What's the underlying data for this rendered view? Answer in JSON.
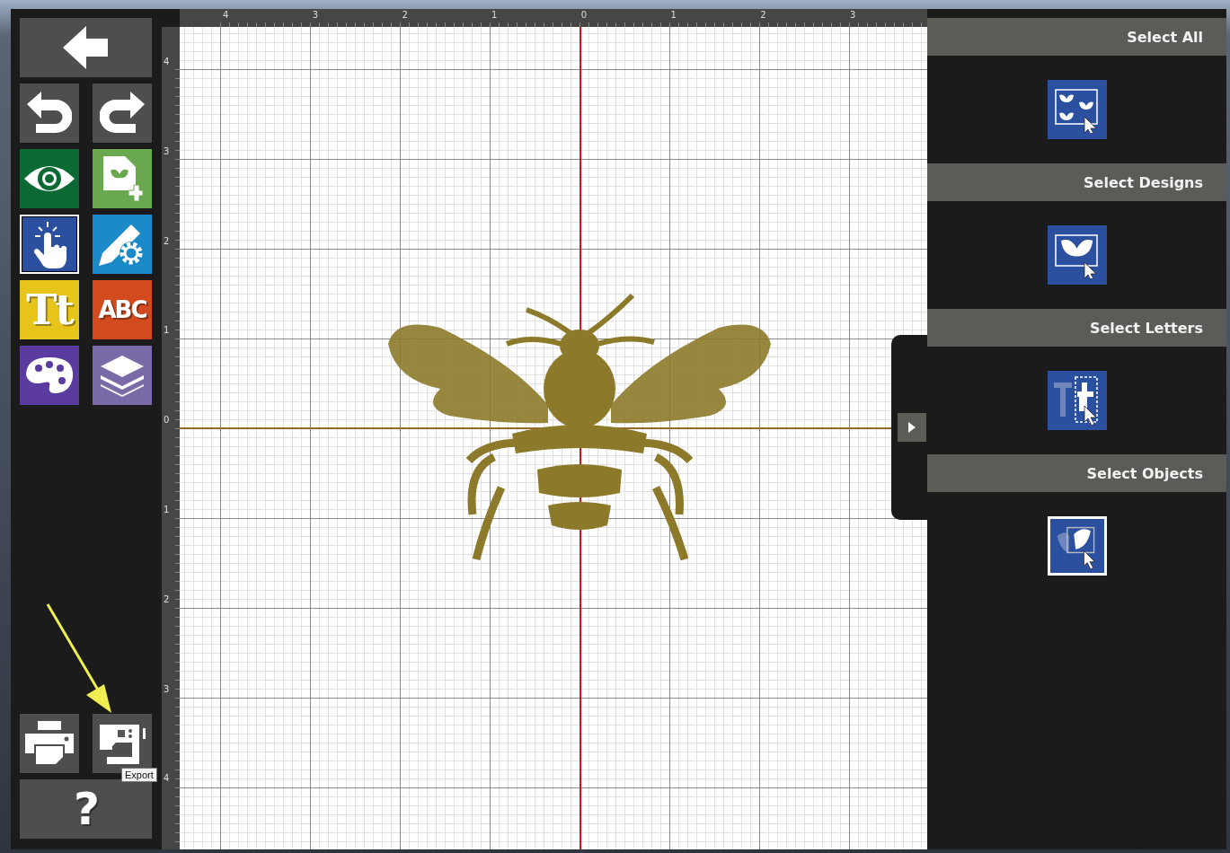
{
  "toolbar": {
    "tools": [
      {
        "kind": "back",
        "selected": false
      },
      {
        "kind": "undo",
        "selected": false
      },
      {
        "kind": "redo",
        "selected": false
      },
      {
        "kind": "preview",
        "selected": false
      },
      {
        "kind": "add-design",
        "selected": false
      },
      {
        "kind": "select",
        "selected": true
      },
      {
        "kind": "edit",
        "selected": false
      },
      {
        "kind": "text",
        "selected": false,
        "glyph": "Tt"
      },
      {
        "kind": "monogram",
        "selected": false,
        "glyph": "ABC"
      },
      {
        "kind": "color",
        "selected": false
      },
      {
        "kind": "layers",
        "selected": false
      }
    ],
    "bottom_tools": [
      {
        "kind": "print",
        "selected": false
      },
      {
        "kind": "export",
        "selected": false,
        "tooltip": "Export"
      },
      {
        "kind": "help",
        "selected": false,
        "glyph": "?"
      }
    ]
  },
  "horizontal_ruler": {
    "labels": [
      "4",
      "3",
      "2",
      "1",
      "0",
      "1",
      "2",
      "3"
    ]
  },
  "vertical_ruler": {
    "labels": [
      "4",
      "3",
      "2",
      "1",
      "0",
      "1",
      "2",
      "3",
      "4"
    ]
  },
  "select_panel": {
    "sections": [
      {
        "heading": "Select All",
        "kind": "all",
        "selected": false
      },
      {
        "heading": "Select Designs",
        "kind": "designs",
        "selected": false
      },
      {
        "heading": "Select Letters",
        "kind": "letters",
        "selected": false
      },
      {
        "heading": "Select Objects",
        "kind": "objects",
        "selected": true
      }
    ]
  }
}
